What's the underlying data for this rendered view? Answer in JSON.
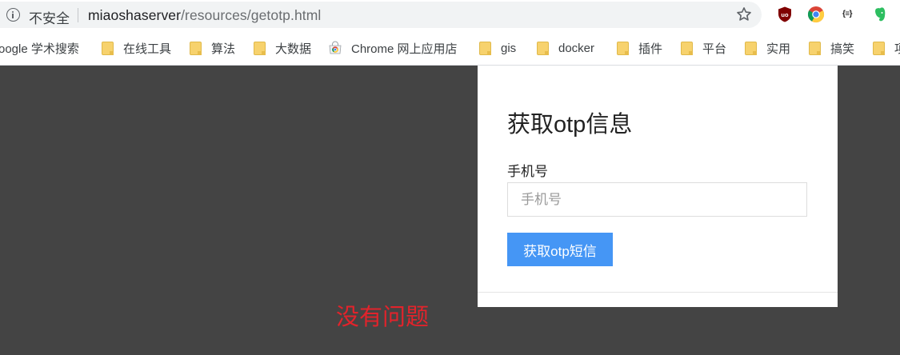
{
  "browser": {
    "security_label": "不安全",
    "url_host": "miaoshaserver",
    "url_path": "/resources/getotp.html",
    "star_icon": "bookmark-star-icon",
    "extensions": [
      {
        "name": "ublock-origin-icon",
        "label": "uo"
      },
      {
        "name": "chrome-icon"
      },
      {
        "name": "json-viewer-icon",
        "label": "{≡}"
      },
      {
        "name": "evernote-icon"
      }
    ]
  },
  "bookmarks": [
    {
      "label": "oogle 学术搜索",
      "icon": "none"
    },
    {
      "label": "在线工具",
      "icon": "folder-icon"
    },
    {
      "label": "算法",
      "icon": "folder-icon"
    },
    {
      "label": "大数据",
      "icon": "folder-icon"
    },
    {
      "label": "Chrome 网上应用店",
      "icon": "chrome-webstore-icon"
    },
    {
      "label": "gis",
      "icon": "folder-icon"
    },
    {
      "label": "docker",
      "icon": "folder-icon"
    },
    {
      "label": "插件",
      "icon": "folder-icon"
    },
    {
      "label": "平台",
      "icon": "folder-icon"
    },
    {
      "label": "实用",
      "icon": "folder-icon"
    },
    {
      "label": "搞笑",
      "icon": "folder-icon"
    },
    {
      "label": "项",
      "icon": "folder-icon"
    }
  ],
  "page": {
    "title": "获取otp信息",
    "phone_label": "手机号",
    "phone_placeholder": "手机号",
    "phone_value": "",
    "submit_label": "获取otp短信",
    "overlay_text": "没有问题",
    "colors": {
      "background": "#444444",
      "button": "#4596f5",
      "overlay_text": "#e2232b"
    }
  }
}
